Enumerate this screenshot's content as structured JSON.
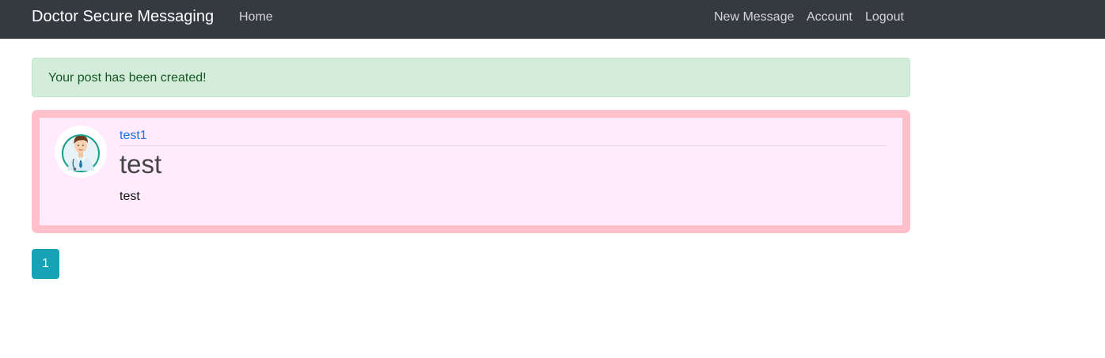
{
  "navbar": {
    "brand": "Doctor Secure Messaging",
    "home": "Home",
    "new_message": "New Message",
    "account": "Account",
    "logout": "Logout"
  },
  "alert": {
    "message": "Your post has been created!"
  },
  "post": {
    "author": "test1",
    "title": "test",
    "content": "test",
    "avatar_icon": "doctor-avatar-icon"
  },
  "pagination": {
    "current_page": "1"
  },
  "colors": {
    "navbar_bg": "#343a40",
    "alert_bg": "#d4edda",
    "alert_text": "#155724",
    "post_border": "#ffc0cb",
    "post_bg": "#ffebfd",
    "link": "#1a73e8",
    "page_button": "#17a2b8"
  }
}
